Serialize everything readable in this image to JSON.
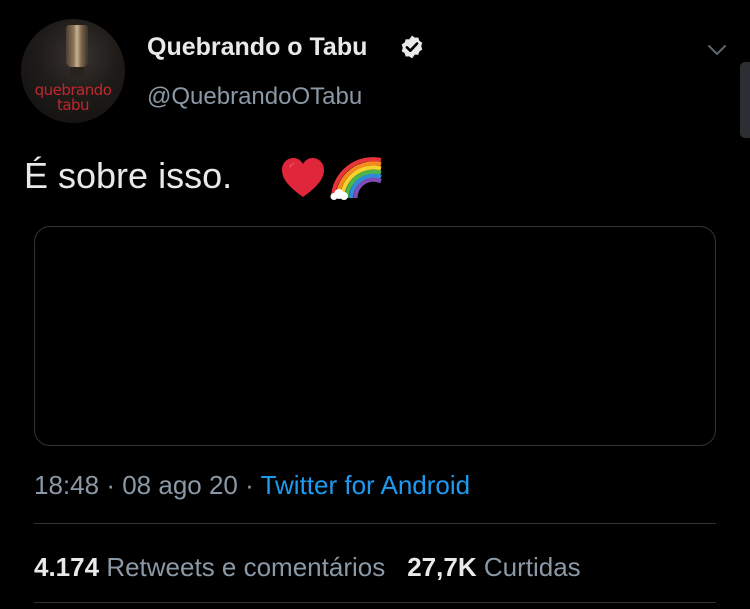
{
  "account": {
    "display_name": "Quebrando o Tabu",
    "handle": "@QuebrandoOTabu",
    "verified": true,
    "avatar_logo_line1": "quebrando",
    "avatar_logo_line2": "tabu"
  },
  "tweet": {
    "text": "É sobre isso.",
    "emojis": [
      "red-heart",
      "rainbow"
    ],
    "time": "18:48",
    "separator": "·",
    "date": "08 ago 20",
    "source": "Twitter for Android"
  },
  "stats": {
    "retweets_count": "4.174",
    "retweets_label": "Retweets e comentários",
    "likes_count": "27,7K",
    "likes_label": "Curtidas"
  },
  "colors": {
    "background": "#000000",
    "text_primary": "#e7e9ea",
    "text_secondary": "#8b98a5",
    "link": "#1d9bf0",
    "border": "#2f3336",
    "logo_red": "#c0272d"
  }
}
